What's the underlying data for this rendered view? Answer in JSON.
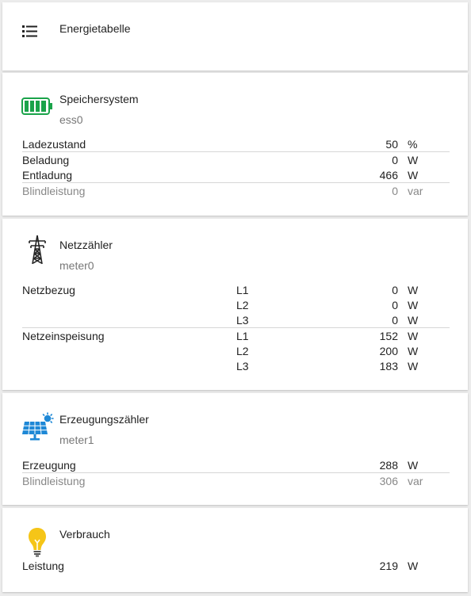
{
  "header": {
    "title": "Energietabelle",
    "menu_icon": "list-icon"
  },
  "storage": {
    "title": "Speichersystem",
    "subtitle": "ess0",
    "icon": "battery-icon",
    "color": "#1aa34a",
    "rows": [
      {
        "label": "Ladezustand",
        "value": "50",
        "unit": "%"
      },
      {
        "label": "Beladung",
        "value": "0",
        "unit": "W"
      },
      {
        "label": "Entladung",
        "value": "466",
        "unit": "W"
      },
      {
        "label": "Blindleistung",
        "value": "0",
        "unit": "var"
      }
    ]
  },
  "grid": {
    "title": "Netzzähler",
    "subtitle": "meter0",
    "icon": "power-pylon-icon",
    "import_label": "Netzbezug",
    "export_label": "Netzeinspeisung",
    "import_phases": [
      {
        "phase": "L1",
        "value": "0",
        "unit": "W"
      },
      {
        "phase": "L2",
        "value": "0",
        "unit": "W"
      },
      {
        "phase": "L3",
        "value": "0",
        "unit": "W"
      }
    ],
    "export_phases": [
      {
        "phase": "L1",
        "value": "152",
        "unit": "W"
      },
      {
        "phase": "L2",
        "value": "200",
        "unit": "W"
      },
      {
        "phase": "L3",
        "value": "183",
        "unit": "W"
      }
    ]
  },
  "production": {
    "title": "Erzeugungszähler",
    "subtitle": "meter1",
    "icon": "solar-panel-icon",
    "color": "#1e88d6",
    "rows": [
      {
        "label": "Erzeugung",
        "value": "288",
        "unit": "W"
      },
      {
        "label": "Blindleistung",
        "value": "306",
        "unit": "var"
      }
    ]
  },
  "consumption": {
    "title": "Verbrauch",
    "icon": "lightbulb-icon",
    "color": "#f5c518",
    "rows": [
      {
        "label": "Leistung",
        "value": "219",
        "unit": "W"
      }
    ]
  }
}
